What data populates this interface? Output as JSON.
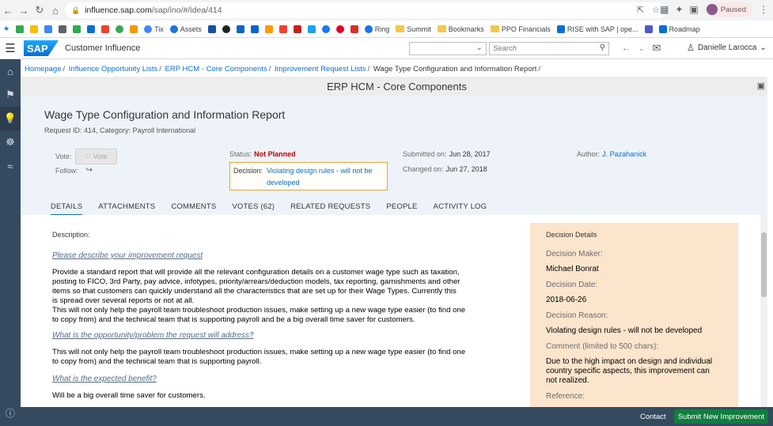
{
  "browser": {
    "url_host": "influence.sap.com",
    "url_path": "/sap/ino/#/idea/414",
    "profile_status": "Paused",
    "bookmarks": [
      "Tix",
      "Assets",
      "Ring",
      "Summit",
      "Bookmarks",
      "PPO Financials",
      "RISE with SAP | ope...",
      "Roadmap"
    ]
  },
  "shell": {
    "logo": "SAP",
    "app_title": "Customer Influence",
    "search_placeholder": "Search",
    "user_name": "Danielle Larocca"
  },
  "breadcrumb": {
    "items": [
      "Homepage",
      "Influence Opportunity Lists",
      "ERP HCM - Core Components",
      "Improvement Request Lists"
    ],
    "current": "Wage Type Configuration and Information Report"
  },
  "page_header": "ERP HCM - Core Components",
  "idea": {
    "title": "Wage Type Configuration and Information Report",
    "subtitle": "Request ID: 414, Category: Payroll International",
    "vote_label": "Vote:",
    "vote_button": "Vote",
    "follow_label": "Follow:",
    "status_label": "Status:",
    "status_value": "Not Planned",
    "decision_label": "Decision:",
    "decision_value_1": "Violating design rules - will not be",
    "decision_value_2": "developed",
    "submitted_label": "Submitted on:",
    "submitted_value": "Jun 28, 2017",
    "changed_label": "Changed on:",
    "changed_value": "Jun 27, 2018",
    "author_label": "Author:",
    "author_value": "J. Pazahanick"
  },
  "tabs": [
    "DETAILS",
    "ATTACHMENTS",
    "COMMENTS",
    "VOTES (62)",
    "RELATED REQUESTS",
    "PEOPLE",
    "ACTIVITY LOG"
  ],
  "content": {
    "description_label": "Description:",
    "q1": "Please describe your improvement request",
    "a1_lines": [
      "Provide a standard report that will provide all the relevant configuration details on a customer wage type such as taxation,",
      "posting to FICO, 3rd Party, pay advice, infotypes, priority/arrears/deduction models, tax reporting, garnishments and other",
      "items so that customers can quickly understand all the characteristics that are set up for their Wage Types.  Currently this",
      "is spread over several reports or not at all.",
      "This will not only help the payroll team troubleshoot production issues, make setting up a new wage type easier (to find one",
      "to copy from) and the technical team that is supporting payroll and be a big overall time saver for customers."
    ],
    "q2": "What is the opportunity/problem the request will address?",
    "a2_lines": [
      "This will not only help the payroll team troubleshoot production issues, make setting up a new wage type easier (to find one",
      "to copy from) and the technical team that is supporting payroll."
    ],
    "q3": "What is the expected benefit?",
    "a3": "Will be a big overall time saver for customers."
  },
  "decision_details": {
    "title": "Decision Details",
    "maker_label": "Decision Maker:",
    "maker_value": "Michael Bonrat",
    "date_label": "Decision Date:",
    "date_value": "2018-06-26",
    "reason_label": "Decision Reason:",
    "reason_value": "Violating design rules - will not be developed",
    "comment_label": "Comment (limited to 500 chars):",
    "comment_value": "Due to the high impact on design and individual country specific aspects, this improvement can not realized.",
    "reference_label": "Reference:"
  },
  "footer": {
    "contact": "Contact",
    "submit": "Submit New Improvement"
  },
  "colors": {
    "shell_rail": "#354a5f",
    "link": "#0a6ed1",
    "status_negative": "#bb0000",
    "decision_panel": "#fbe5cc",
    "submit_button": "#107e3e"
  }
}
